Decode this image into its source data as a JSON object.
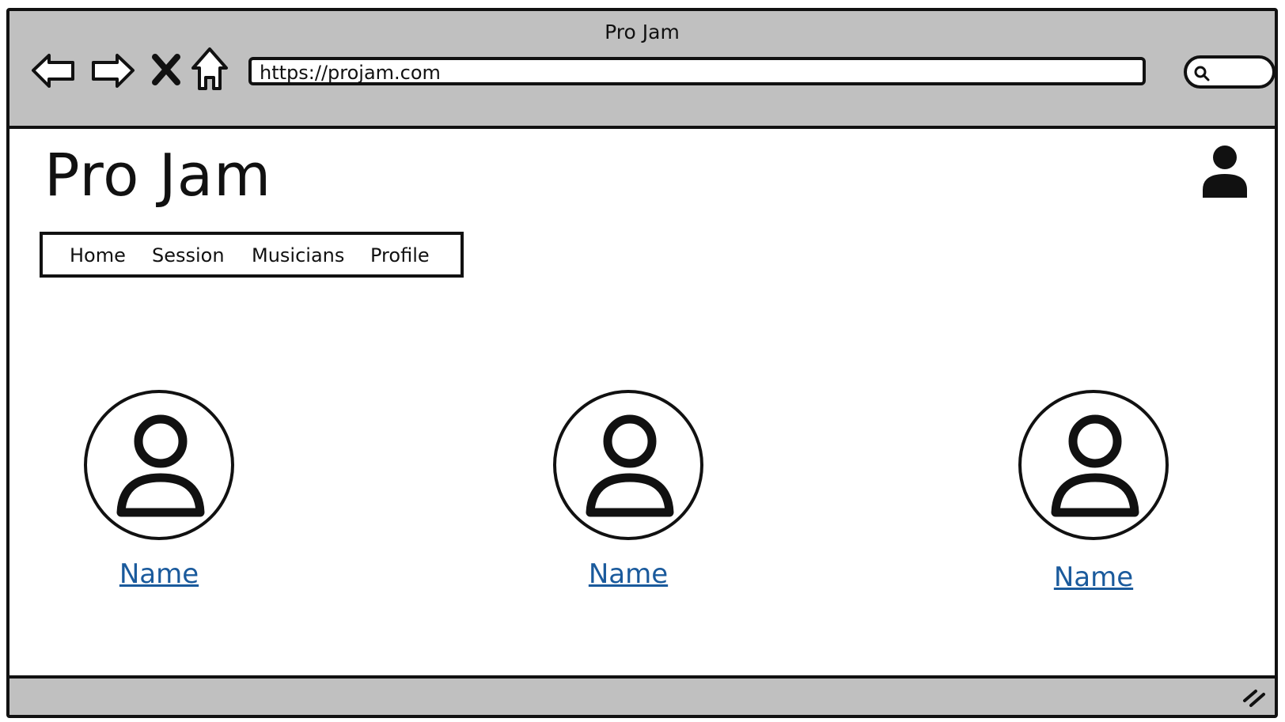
{
  "browser": {
    "title": "Pro Jam",
    "url": "https://projam.com",
    "controls": {
      "back": "back-arrow-icon",
      "forward": "forward-arrow-icon",
      "stop": "close-icon",
      "home": "home-icon"
    },
    "search_icon": "search-icon"
  },
  "site": {
    "title": "Pro Jam",
    "account_icon": "user-icon"
  },
  "nav": {
    "items": [
      {
        "label": "Home"
      },
      {
        "label": "Session"
      },
      {
        "label": "Musicians"
      },
      {
        "label": "Profile"
      }
    ]
  },
  "musicians": [
    {
      "name": "Name",
      "avatar_icon": "user-avatar-icon"
    },
    {
      "name": "Name",
      "avatar_icon": "user-avatar-icon"
    },
    {
      "name": "Name",
      "avatar_icon": "user-avatar-icon"
    }
  ],
  "colors": {
    "chrome": "#c0c0c0",
    "border": "#111111",
    "link": "#1a5a9c",
    "background": "#ffffff"
  }
}
